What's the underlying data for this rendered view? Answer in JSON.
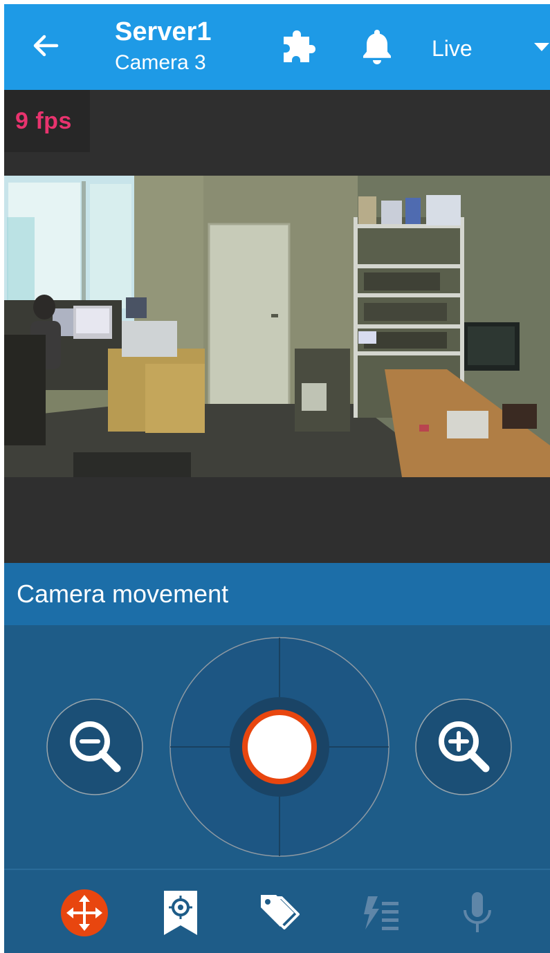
{
  "header": {
    "title": "Server1",
    "subtitle": "Camera 3",
    "mode": "Live",
    "icons": [
      "back-arrow-icon",
      "puzzle-icon",
      "bell-icon",
      "dropdown-caret-icon"
    ]
  },
  "video": {
    "fps_label": "9 fps"
  },
  "ptz": {
    "section_title": "Camera movement",
    "icons": [
      "zoom-out-icon",
      "joystick",
      "zoom-in-icon"
    ]
  },
  "toolbar": {
    "icons": [
      "ptz-move-icon",
      "preset-location-icon",
      "tags-icon",
      "relay-list-icon",
      "microphone-icon"
    ]
  },
  "colors": {
    "app_bar": "#1e9ae6",
    "ptz_header": "#1c6ea8",
    "ptz_panel": "#1e5c88",
    "fps_text": "#e8336e",
    "accent_orange": "#e8460f",
    "video_background": "#2f2f2f"
  }
}
